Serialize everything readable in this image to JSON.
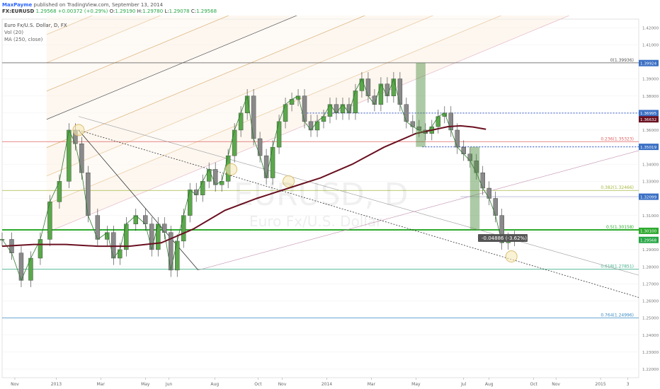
{
  "header": {
    "author": "MaxPayme",
    "published_text": "published on TradingView.com, September 13, 2014",
    "symbol": "FX:EURUSD",
    "last": "1.29568",
    "change": "+0.00372 (+0.29%)",
    "open_label": "O:",
    "open": "1.29190",
    "high_label": "H:",
    "high": "1.29780",
    "low_label": "L:",
    "low": "1.29078",
    "close_label": "C:",
    "close": "1.29568"
  },
  "legend": {
    "title": "Euro Fx/U.S. Dollar, D, FX",
    "vol": "Vol (20)",
    "ma": "MA (250, close)"
  },
  "watermark": {
    "symbol": "EURUSD, D",
    "name": "Euro Fx/U.S. Dollar"
  },
  "chart_data": {
    "type": "line",
    "title": "Euro Fx/U.S. Dollar, D, FX",
    "ylim": [
      1.215,
      1.425
    ],
    "xlim": [
      0,
      100
    ],
    "x_ticks": [
      {
        "label": "Nov",
        "x": 2
      },
      {
        "label": "2013",
        "x": 8.5
      },
      {
        "label": "Mar",
        "x": 15.5
      },
      {
        "label": "May",
        "x": 22.5
      },
      {
        "label": "Jun",
        "x": 26.2
      },
      {
        "label": "Aug",
        "x": 33.4
      },
      {
        "label": "Oct",
        "x": 40.2
      },
      {
        "label": "Nov",
        "x": 44
      },
      {
        "label": "2014",
        "x": 51
      },
      {
        "label": "Mar",
        "x": 58
      },
      {
        "label": "May",
        "x": 65
      },
      {
        "label": "Jul",
        "x": 72.5
      },
      {
        "label": "Aug",
        "x": 76.5
      },
      {
        "label": "Oct",
        "x": 83.5
      },
      {
        "label": "Nov",
        "x": 87
      },
      {
        "label": "2015",
        "x": 94
      },
      {
        "label": "3",
        "x": 98.3
      }
    ],
    "y_ticks": [
      "1.42000",
      "1.41000",
      "1.40000",
      "1.39000",
      "1.38000",
      "1.37000",
      "1.36000",
      "1.35000",
      "1.34000",
      "1.33000",
      "1.32000",
      "1.31000",
      "1.30000",
      "1.29000",
      "1.28000",
      "1.27000",
      "1.26000",
      "1.25000",
      "1.24000",
      "1.23000",
      "1.22000"
    ],
    "price_tags": [
      {
        "label": "1.39924",
        "value": 1.39924,
        "color": "#3a6fc4"
      },
      {
        "label": "1.36995",
        "value": 1.36995,
        "color": "#3a6fc4"
      },
      {
        "label": "1.36632",
        "value": 1.36632,
        "color": "#6a1020"
      },
      {
        "label": "1.35019",
        "value": 1.35019,
        "color": "#3a6fc4"
      },
      {
        "label": "1.32099",
        "value": 1.32099,
        "color": "#3a6fc4"
      },
      {
        "label": "1.30100",
        "value": 1.301,
        "color": "#2eaa2e"
      },
      {
        "label": "1.29568",
        "value": 1.29568,
        "color": "#26a644"
      }
    ],
    "fib_levels": [
      {
        "label": "0(1.39936)",
        "value": 1.39936,
        "color": "#555555"
      },
      {
        "label": "0.236(1.35323)",
        "value": 1.35323,
        "color": "#e06060"
      },
      {
        "label": "0.382(1.32466)",
        "value": 1.32466,
        "color": "#a8b840"
      },
      {
        "label": "0.5(1.30158)",
        "value": 1.30158,
        "color": "#2eaa2e"
      },
      {
        "label": "0.618(1.27851)",
        "value": 1.27851,
        "color": "#40b08a"
      },
      {
        "label": "0.764(1.24996)",
        "value": 1.24996,
        "color": "#3a8ac4"
      }
    ],
    "measure_label": "-0.04886 (-3.62%)",
    "price_series": {
      "name": "EURUSD",
      "x": [
        0,
        1.5,
        3,
        4.5,
        6,
        7.5,
        9,
        10.5,
        11.5,
        12.5,
        13.5,
        15,
        16.5,
        17.5,
        18.5,
        19.5,
        21,
        22.5,
        23.5,
        24.5,
        25.5,
        26.5,
        27.5,
        28.5,
        29.5,
        30.5,
        31.5,
        32.5,
        33.5,
        34.5,
        35.5,
        36.5,
        37.5,
        38.5,
        39.5,
        40.5,
        41.5,
        42.5,
        43.5,
        44.5,
        45.5,
        46.5,
        47.5,
        48.5,
        49.5,
        50.5,
        51.5,
        52.5,
        53.5,
        54.5,
        55.5,
        56.5,
        57.5,
        58.5,
        59.5,
        60.5,
        61.5,
        62.5,
        63.5,
        64.5,
        65.5,
        66.5,
        67.5,
        68.5,
        69.5,
        70.5,
        71.5,
        72.5,
        73.5,
        74.5,
        75.5,
        76.5,
        77.5,
        78.5,
        79.5,
        80.5
      ],
      "values": [
        1.296,
        1.288,
        1.272,
        1.285,
        1.296,
        1.318,
        1.33,
        1.36,
        1.352,
        1.335,
        1.31,
        1.296,
        1.3,
        1.285,
        1.29,
        1.305,
        1.31,
        1.305,
        1.29,
        1.305,
        1.3,
        1.278,
        1.295,
        1.31,
        1.325,
        1.322,
        1.33,
        1.337,
        1.328,
        1.33,
        1.345,
        1.36,
        1.37,
        1.38,
        1.355,
        1.345,
        1.332,
        1.35,
        1.365,
        1.375,
        1.378,
        1.38,
        1.365,
        1.36,
        1.365,
        1.368,
        1.375,
        1.37,
        1.375,
        1.37,
        1.383,
        1.39,
        1.38,
        1.375,
        1.387,
        1.38,
        1.39,
        1.375,
        1.365,
        1.362,
        1.36,
        1.358,
        1.362,
        1.368,
        1.37,
        1.36,
        1.35,
        1.346,
        1.342,
        1.335,
        1.326,
        1.32,
        1.31,
        1.294,
        1.296,
        1.297
      ]
    },
    "ma_series": {
      "name": "MA (250, close)",
      "x": [
        0,
        5,
        10,
        15,
        20,
        25,
        30,
        35,
        40,
        45,
        50,
        55,
        60,
        65,
        70,
        72,
        74,
        76
      ],
      "values": [
        1.292,
        1.293,
        1.293,
        1.292,
        1.292,
        1.294,
        1.302,
        1.313,
        1.32,
        1.326,
        1.332,
        1.34,
        1.35,
        1.358,
        1.362,
        1.3625,
        1.3618,
        1.3605
      ]
    }
  }
}
